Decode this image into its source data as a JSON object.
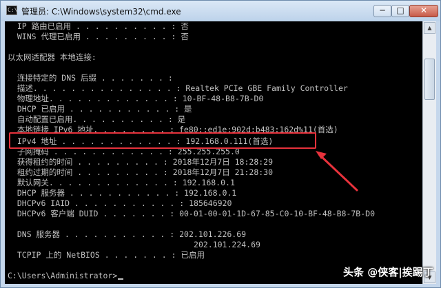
{
  "window": {
    "title": "管理员: C:\\Windows\\system32\\cmd.exe",
    "minimize": "─",
    "maximize": "□",
    "close": "✕"
  },
  "console": {
    "lines": [
      "  IP 路由已启用 . . . . . . . . . . : 否",
      "  WINS 代理已启用 . . . . . . . . . : 否",
      "",
      "以太网适配器 本地连接:",
      "",
      "  连接特定的 DNS 后缀 . . . . . . . :",
      "  描述. . . . . . . . . . . . . . . : Realtek PCIe GBE Family Controller",
      "  物理地址. . . . . . . . . . . . . : 10-BF-48-B8-7B-D0",
      "  DHCP 已启用 . . . . . . . . . . . : 是",
      "  自动配置已启用. . . . . . . . . . : 是",
      "  本地链接 IPv6 地址. . . . . . . . : fe80::ed1e:902d:b483:162d%11(首选)",
      "  IPv4 地址 . . . . . . . . . . . . : 192.168.0.111(首选)",
      "  子网掩码 . . . . . . . . . . . . : 255.255.255.0",
      "  获得租约的时间 . . . . . . . . . : 2018年12月7日 18:28:29",
      "  租约过期的时间 . . . . . . . . . : 2018年12月7日 21:28:30",
      "  默认网关. . . . . . . . . . . . . : 192.168.0.1",
      "  DHCP 服务器 . . . . . . . . . . . : 192.168.0.1",
      "  DHCPv6 IAID . . . . . . . . . . . : 185646920",
      "  DHCPv6 客户端 DUID . . . . . . . : 00-01-00-01-1D-67-85-C0-10-BF-48-B8-7B-D0",
      "",
      "  DNS 服务器 . . . . . . . . . . . : 202.101.226.69",
      "                                       202.101.224.69",
      "  TCPIP 上的 NetBIOS . . . . . . . : 已启用",
      "",
      "C:\\Users\\Administrator>"
    ]
  },
  "watermark": "头条 @侠客|挨踢丁",
  "colors": {
    "console_bg": "#000000",
    "console_text": "#c0c0c0",
    "highlight": "#e8323c"
  }
}
